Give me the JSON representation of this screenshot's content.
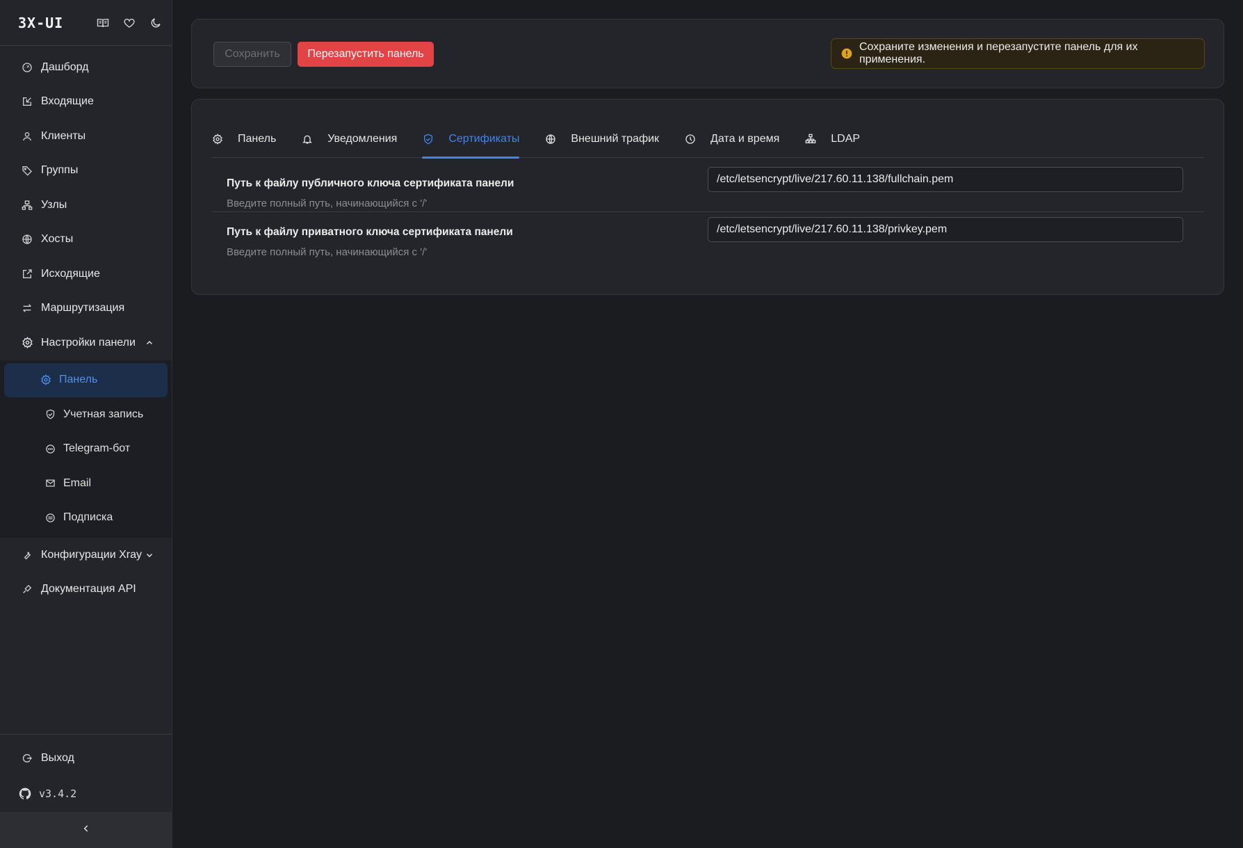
{
  "brand": {
    "title": "3X-UI",
    "icons": [
      "book-icon",
      "heart-icon",
      "moon-icon"
    ]
  },
  "nav": {
    "items": [
      {
        "label": "Дашборд",
        "icon": "dashboard-icon"
      },
      {
        "label": "Входящие",
        "icon": "inbound-icon"
      },
      {
        "label": "Клиенты",
        "icon": "user-icon"
      },
      {
        "label": "Группы",
        "icon": "tag-icon"
      },
      {
        "label": "Узлы",
        "icon": "nodes-icon"
      },
      {
        "label": "Хосты",
        "icon": "globe-icon"
      },
      {
        "label": "Исходящие",
        "icon": "outbound-icon"
      },
      {
        "label": "Маршрутизация",
        "icon": "routing-icon"
      }
    ],
    "settings_group": {
      "label": "Настройки панели",
      "sub_items": [
        {
          "label": "Панель",
          "icon": "gear-icon",
          "active": true
        },
        {
          "label": "Учетная запись",
          "icon": "shield-icon"
        },
        {
          "label": "Telegram-бот",
          "icon": "chat-icon"
        },
        {
          "label": "Email",
          "icon": "mail-icon"
        },
        {
          "label": "Подписка",
          "icon": "subscription-icon"
        }
      ]
    },
    "xray": {
      "label": "Конфигурации Xray"
    },
    "api": {
      "label": "Документация API"
    }
  },
  "footer": {
    "logout": "Выход",
    "version": "v3.4.2"
  },
  "toolbar": {
    "save_label": "Сохранить",
    "restart_label": "Перезапустить панель",
    "alert_text": "Сохраните изменения и перезапустите панель для их применения."
  },
  "tabs": [
    {
      "label": "Панель",
      "icon": "gear-icon"
    },
    {
      "label": "Уведомления",
      "icon": "bell-icon"
    },
    {
      "label": "Сертификаты",
      "icon": "shield-icon",
      "active": true
    },
    {
      "label": "Внешний трафик",
      "icon": "globe-icon"
    },
    {
      "label": "Дата и время",
      "icon": "clock-icon"
    },
    {
      "label": "LDAP",
      "icon": "hierarchy-icon"
    }
  ],
  "settings": [
    {
      "title": "Путь к файлу публичного ключа сертификата панели",
      "description": "Введите полный путь, начинающийся с '/'",
      "value": "/etc/letsencrypt/live/217.60.11.138/fullchain.pem"
    },
    {
      "title": "Путь к файлу приватного ключа сертификата панели",
      "description": "Введите полный путь, начинающийся с '/'",
      "value": "/etc/letsencrypt/live/217.60.11.138/privkey.pem"
    }
  ],
  "colors": {
    "accent": "#3f84f0",
    "danger": "#e24446",
    "warning": "#e0a21a",
    "bg": "#1b1c20",
    "panel": "#23252b"
  }
}
